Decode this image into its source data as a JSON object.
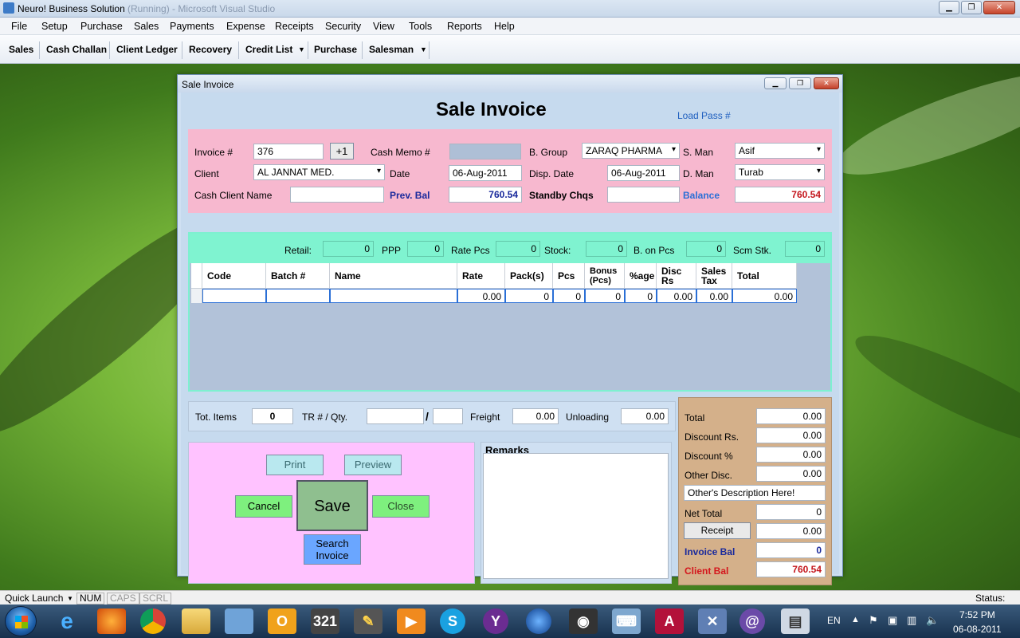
{
  "window": {
    "title": "Neuro! Business Solution",
    "title_faded": "(Running) - Microsoft Visual Studio"
  },
  "menu": [
    "File",
    "Setup",
    "Purchase",
    "Sales",
    "Payments",
    "Expense",
    "Receipts",
    "Security",
    "View",
    "Tools",
    "Reports",
    "Help"
  ],
  "toolbar": {
    "items": [
      "Sales",
      "Cash Challan",
      "Client Ledger",
      "Recovery",
      "Credit List",
      "Purchase",
      "Salesman"
    ]
  },
  "dialog": {
    "title": "Sale Invoice",
    "heading": "Sale Invoice",
    "load_pass": "Load Pass #",
    "header": {
      "invoice_label": "Invoice #",
      "invoice_value": "376",
      "plus_one": "+1",
      "cash_memo_label": "Cash Memo #",
      "cash_memo_value": "",
      "b_group_label": "B. Group",
      "b_group_value": "ZARAQ PHARMA",
      "s_man_label": "S. Man",
      "s_man_value": "Asif",
      "client_label": "Client",
      "client_value": "AL JANNAT MED.",
      "date_label": "Date",
      "date_value": "06-Aug-2011",
      "disp_date_label": "Disp. Date",
      "disp_date_value": "06-Aug-2011",
      "d_man_label": "D. Man",
      "d_man_value": "Turab",
      "cash_client_label": "Cash Client Name",
      "cash_client_value": "",
      "prev_bal_label": "Prev. Bal",
      "prev_bal_value": "760.54",
      "standby_label": "Standby Chqs",
      "standby_value": "",
      "balance_label": "Balance",
      "balance_value": "760.54"
    },
    "stock": {
      "retail_label": "Retail:",
      "retail": "0",
      "ppp_label": "PPP",
      "ppp": "0",
      "rate_pcs_label": "Rate Pcs",
      "rate_pcs": "0",
      "stock_label": "Stock:",
      "stock": "0",
      "b_on_pcs_label": "B. on Pcs",
      "b_on_pcs": "0",
      "scm_label": "Scm Stk.",
      "scm": "0"
    },
    "grid": {
      "columns": [
        "Code",
        "Batch #",
        "Name",
        "Rate",
        "Pack(s)",
        "Pcs",
        "Bonus (Pcs)",
        "%age",
        "Disc Rs",
        "Sales Tax",
        "Total"
      ],
      "row": [
        "",
        "",
        "",
        "0.00",
        "0",
        "0",
        "0",
        "0",
        "0.00",
        "0.00",
        "0.00"
      ]
    },
    "totals_bar": {
      "tot_items_label": "Tot. Items",
      "tot_items": "0",
      "tr_label": "TR # / Qty.",
      "tr_value": "",
      "qty_value": "",
      "slash": "/",
      "freight_label": "Freight",
      "freight": "0.00",
      "unloading_label": "Unloading",
      "unloading": "0.00"
    },
    "buttons": {
      "print": "Print",
      "preview": "Preview",
      "cancel": "Cancel",
      "save": "Save",
      "close": "Close",
      "search_invoice": "Search Invoice"
    },
    "remarks_label": "Remarks",
    "summary": {
      "total_label": "Total",
      "total": "0.00",
      "discount_rs_label": "Discount Rs.",
      "discount_rs": "0.00",
      "discount_pct_label": "Discount %",
      "discount_pct": "0.00",
      "other_disc_label": "Other Disc.",
      "other_disc": "0.00",
      "other_desc": "Other's Description Here!",
      "net_total_label": "Net Total",
      "net_total": "0",
      "receipt_button": "Receipt",
      "receipt": "0.00",
      "invoice_bal_label": "Invoice Bal",
      "invoice_bal": "0",
      "client_bal_label": "Client Bal",
      "client_bal": "760.54"
    }
  },
  "statusbar": {
    "quick_launch": "Quick Launch",
    "num": "NUM",
    "caps": "CAPS",
    "scrl": "SCRL",
    "status": "Status:"
  },
  "taskbar": {
    "lang": "EN",
    "time": "7:52 PM",
    "date": "06-08-2011"
  }
}
